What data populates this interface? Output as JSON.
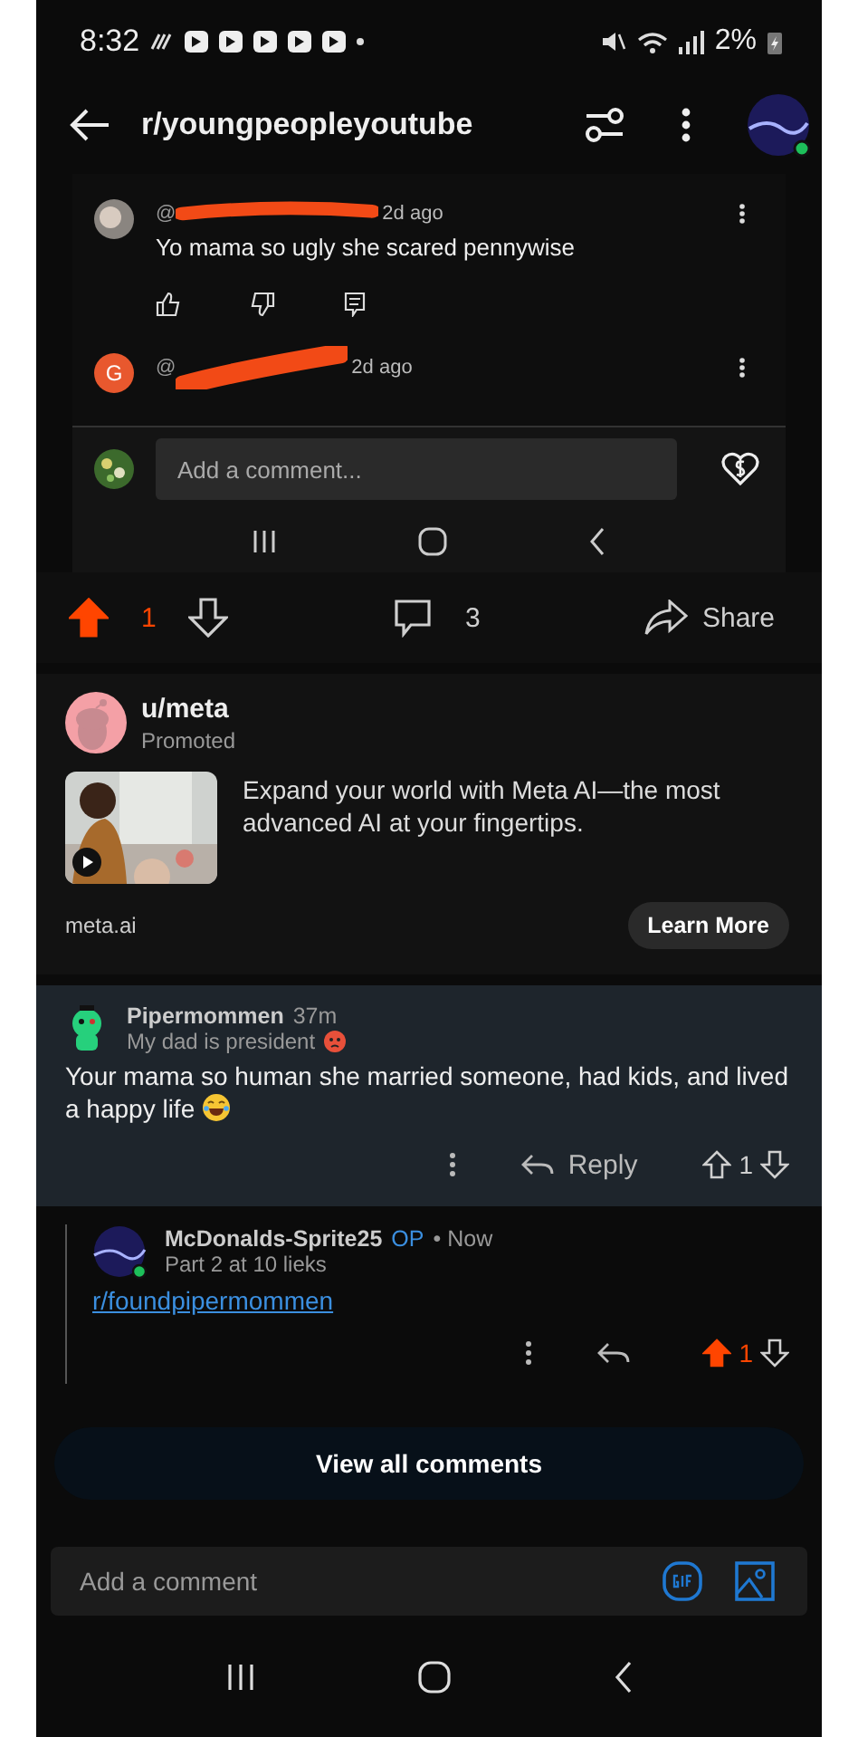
{
  "status_bar": {
    "time": "8:32",
    "battery": "2%"
  },
  "header": {
    "title": "r/youngpeopleyoutube"
  },
  "embedded_screenshot": {
    "comments": [
      {
        "handle": "@",
        "time": "2d ago",
        "text": "Yo mama so ugly she scared pennywise"
      },
      {
        "handle": "@",
        "time": "2d ago",
        "kind": "letter",
        "avatar_letter": "G"
      }
    ],
    "comment_field": {
      "placeholder": "Add a comment..."
    }
  },
  "post_actions": {
    "upvoted": true,
    "score": "1",
    "comments": "3",
    "share": "Share"
  },
  "ad": {
    "user": "u/meta",
    "label": "Promoted",
    "text": "Expand your world with Meta AI—the most advanced AI at your fingertips.",
    "domain": "meta.ai",
    "button": "Learn More"
  },
  "comments": [
    {
      "kind": "top",
      "author": "Pipermommen",
      "time": "37m",
      "flair": "My dad is president",
      "text": "Your mama so human she married someone, had kids, and lived a happy life",
      "reply": "Reply",
      "score": "1",
      "upvoted": false
    },
    {
      "kind": "reply",
      "author": "McDonalds-Sprite25",
      "op_badge": "OP",
      "time": "• Now",
      "flair": "Part 2 at 10 lieks",
      "link": "r/foundpipermommen",
      "score": "1",
      "upvoted": true
    }
  ],
  "view_all": "View all comments",
  "composer": {
    "placeholder": "Add a comment"
  }
}
